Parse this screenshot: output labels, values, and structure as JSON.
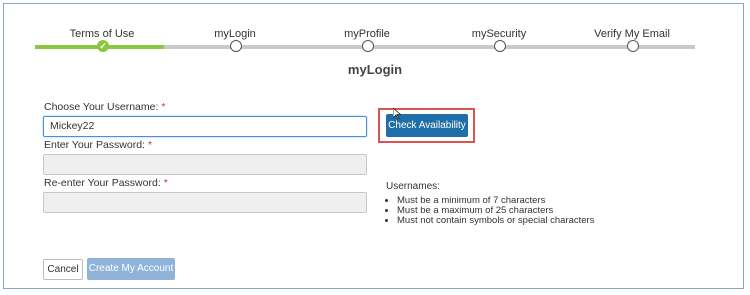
{
  "stepper": {
    "steps": [
      {
        "label": "Terms of Use",
        "state": "completed"
      },
      {
        "label": "myLogin",
        "state": "current"
      },
      {
        "label": "myProfile",
        "state": "upcoming"
      },
      {
        "label": "mySecurity",
        "state": "upcoming"
      },
      {
        "label": "Verify My Email",
        "state": "upcoming"
      }
    ],
    "completed_mark": "✓",
    "current_title": "myLogin",
    "colors": {
      "completed": "#8dc63f",
      "track": "#c9c9c9"
    }
  },
  "form": {
    "username": {
      "label": "Choose Your Username:",
      "required_mark": "*",
      "value": "Mickey22"
    },
    "password": {
      "label": "Enter Your Password:",
      "required_mark": "*",
      "value": ""
    },
    "confirm_password": {
      "label": "Re-enter Your Password:",
      "required_mark": "*",
      "value": ""
    },
    "check_availability_label": "Check Availability"
  },
  "hints": {
    "title": "Usernames:",
    "items": [
      "Must be a minimum of 7 characters",
      "Must be a maximum of 25 characters",
      "Must not contain symbols or special characters"
    ]
  },
  "actions": {
    "cancel_label": "Cancel",
    "create_label": "Create My Account"
  },
  "colors": {
    "primary": "#1e6fa8",
    "primary_disabled": "#8fb3d9",
    "highlight": "#d9534f"
  }
}
